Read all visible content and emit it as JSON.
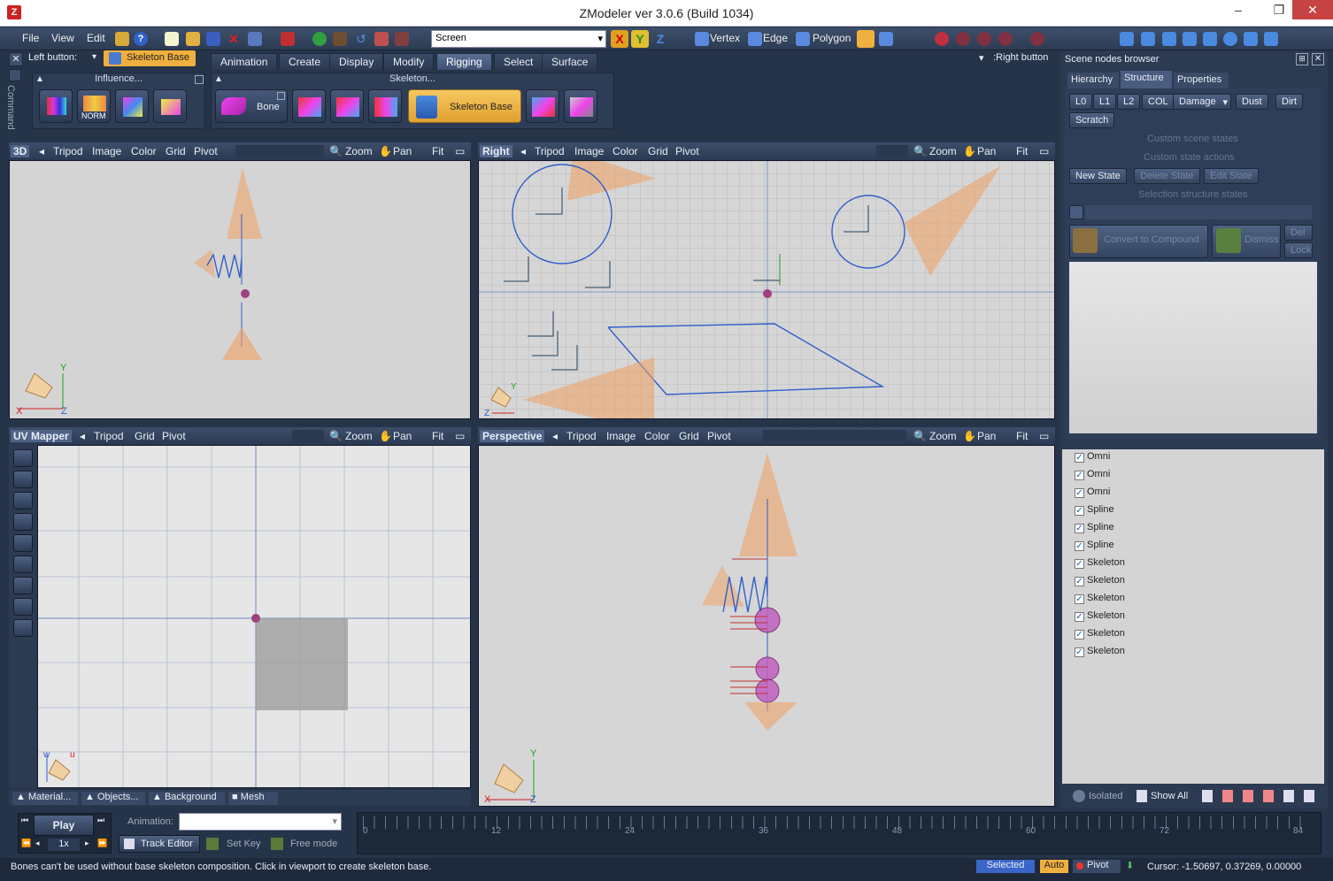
{
  "window": {
    "title": "ZModeler ver 3.0.6 (Build 1034)"
  },
  "menu": [
    "File",
    "View",
    "Edit"
  ],
  "toolbar": {
    "screen_select": "Screen",
    "vertex": "Vertex",
    "edge": "Edge",
    "polygon": "Polygon"
  },
  "buttons_bar": {
    "left_button_label": "Left button:",
    "left_button_value": "Skeleton Base",
    "right_button_label": ":Right button"
  },
  "tabs": [
    "Animation",
    "Create",
    "Display",
    "Modify",
    "Rigging",
    "Select",
    "Surface"
  ],
  "ribbon": {
    "influence_title": "Influence...",
    "skeleton_title": "Skeleton...",
    "norm_label": "NORM",
    "bone_label": "Bone",
    "skeleton_base_label": "Skeleton Base"
  },
  "vertical_tab": "Command",
  "viewports": {
    "vp3d": {
      "title": "3D",
      "items": [
        "Tripod",
        "Image",
        "Color",
        "Grid",
        "Pivot"
      ],
      "zoom": "Zoom",
      "pan": "Pan",
      "fit": "Fit"
    },
    "right": {
      "title": "Right",
      "items": [
        "Tripod",
        "Image",
        "Color",
        "Grid",
        "Pivot"
      ],
      "zoom": "Zoom",
      "pan": "Pan",
      "fit": "Fit"
    },
    "uv": {
      "title": "UV Mapper",
      "items": [
        "Tripod",
        "Grid",
        "Pivot"
      ],
      "zoom": "Zoom",
      "pan": "Pan",
      "fit": "Fit"
    },
    "persp": {
      "title": "Perspective",
      "items": [
        "Tripod",
        "Image",
        "Color",
        "Grid",
        "Pivot"
      ],
      "zoom": "Zoom",
      "pan": "Pan",
      "fit": "Fit"
    }
  },
  "uv_bottom_tabs": [
    "Material...",
    "Objects...",
    "Background",
    "Mesh"
  ],
  "axes": {
    "x": "X",
    "y": "Y",
    "z": "Z",
    "u": "u",
    "w": "w"
  },
  "scene_browser": {
    "title": "Scene nodes browser",
    "tabs": [
      "Hierarchy",
      "Structure",
      "Properties"
    ],
    "lod_buttons": [
      "L0",
      "L1",
      "L2",
      "COL",
      "Damage",
      "Dust",
      "Dirt",
      "Scratch"
    ],
    "custom_scene_states": "Custom scene states",
    "custom_state_actions": "Custom state actions",
    "new_state": "New State",
    "delete_state": "Delete State",
    "edit_state": "Edit State",
    "selection_structure_states": "Selection structure states",
    "convert_to_compound": "Convert to Compound",
    "dismiss": "Dismiss",
    "del": "Del",
    "lock": "Lock",
    "nodes": [
      "Omni",
      "Omni",
      "Omni",
      "Spline",
      "Spline",
      "Spline",
      "Skeleton",
      "Skeleton",
      "Skeleton",
      "Skeleton",
      "Skeleton",
      "Skeleton"
    ],
    "isolated": "Isolated",
    "show_all": "Show All"
  },
  "timeline": {
    "play": "Play",
    "speed": "1x",
    "animation_label": "Animation:",
    "track_editor": "Track Editor",
    "set_key": "Set Key",
    "free_mode": "Free mode",
    "ticks": [
      "0",
      "12",
      "24",
      "36",
      "48",
      "60",
      "72",
      "84"
    ]
  },
  "statusbar": {
    "message": "Bones can't be used without base skeleton composition. Click in viewport to create skeleton base.",
    "selected": "Selected",
    "auto": "Auto",
    "pivot": "Pivot",
    "cursor": "Cursor: -1.50697, 0.37269, 0.00000"
  },
  "colors": {
    "accent": "#f0b040",
    "wire": "#2f5fc8",
    "cone": "#f0a060",
    "bone": "#a04080"
  }
}
